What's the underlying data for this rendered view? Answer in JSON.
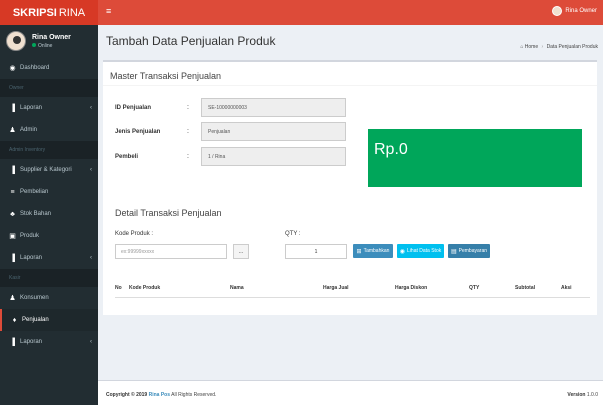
{
  "brand": {
    "bold": "SKRIPSI",
    "light": "RINA"
  },
  "user": {
    "name": "Rina Owner",
    "status": "Online"
  },
  "menu": [
    {
      "type": "item",
      "icon": "dashboard-icon",
      "glyph": "◉",
      "label": "Dashboard",
      "chevron": false
    },
    {
      "type": "header",
      "label": "Owner"
    },
    {
      "type": "item",
      "icon": "book-icon",
      "glyph": "▐",
      "label": "Laporan",
      "chevron": true
    },
    {
      "type": "item",
      "icon": "users-icon",
      "glyph": "♟",
      "label": "Admin",
      "chevron": false
    },
    {
      "type": "header",
      "label": "Admin Inventory"
    },
    {
      "type": "item",
      "icon": "book-icon",
      "glyph": "▐",
      "label": "Supplier & Kategori",
      "chevron": true
    },
    {
      "type": "item",
      "icon": "cart-icon",
      "glyph": "≡",
      "label": "Pembelian",
      "chevron": false
    },
    {
      "type": "item",
      "icon": "cubes-icon",
      "glyph": "♣",
      "label": "Stok Bahan",
      "chevron": false
    },
    {
      "type": "item",
      "icon": "image-icon",
      "glyph": "▣",
      "label": "Produk",
      "chevron": false
    },
    {
      "type": "item",
      "icon": "book-icon",
      "glyph": "▐",
      "label": "Laporan",
      "chevron": true
    },
    {
      "type": "header",
      "label": "Kasir"
    },
    {
      "type": "item",
      "icon": "users-icon",
      "glyph": "♟",
      "label": "Konsumen",
      "chevron": false
    },
    {
      "type": "item",
      "icon": "cart-icon",
      "glyph": "♦",
      "label": "Penjualan",
      "chevron": false,
      "active": true
    },
    {
      "type": "item",
      "icon": "book-icon",
      "glyph": "▐",
      "label": "Laporan",
      "chevron": true
    }
  ],
  "topbar": {
    "user": "Rina Owner"
  },
  "page": {
    "title": "Tambah Data Penjualan Produk"
  },
  "breadcrumb": {
    "home": "Home",
    "current": "Data Penjualan Produk"
  },
  "master": {
    "title": "Master Transaksi Penjualan",
    "id_label": "ID Penjualan",
    "id_value": "SE-10000000003",
    "jenis_label": "Jenis Penjualan",
    "jenis_value": "Penjualan",
    "pembeli_label": "Pembeli",
    "pembeli_value": "1 / Rina",
    "colon": ":",
    "total": "Rp.0"
  },
  "detail": {
    "title": "Detail Transaksi Penjualan",
    "kode_label": "Kode Produk :",
    "kode_placeholder": "ex:99999xxxxx",
    "dots": "...",
    "qty_label": "QTY :",
    "qty_value": "1",
    "btn_tambahkan": "Tambahkan",
    "btn_stok": "Lihat Data Stok",
    "btn_pembayaran": "Pembayaran"
  },
  "table": {
    "headers": [
      "No",
      "Kode Produk",
      "Nama",
      "Harga Jual",
      "Harga Diskon",
      "QTY",
      "Subtotal",
      "Aksi"
    ]
  },
  "footer": {
    "copyright_prefix": "Copyright © 2019",
    "brand_link": "Rina Pos",
    "copyright_suffix": "All Rights Reserved.",
    "version_label": "Version",
    "version_value": "1.0.0"
  },
  "colors": {
    "header": "#dd4b39",
    "brand": "#d73925",
    "sidebar": "#222d32",
    "total": "#00a65a",
    "button": "#3c8dbc"
  }
}
